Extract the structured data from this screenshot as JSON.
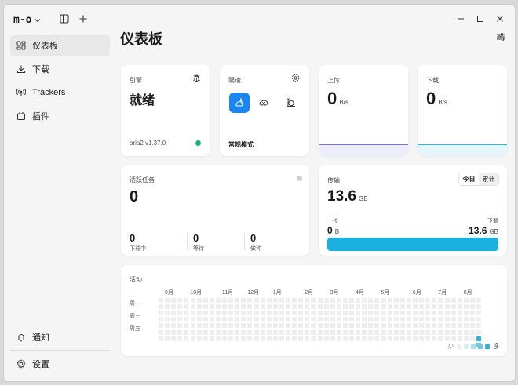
{
  "app": {
    "logo": "m-o"
  },
  "header": {
    "title": "仪表板"
  },
  "sidebar": {
    "items": [
      {
        "label": "仪表板",
        "icon": "dashboard-icon",
        "active": true
      },
      {
        "label": "下载",
        "icon": "download-icon"
      },
      {
        "label": "Trackers",
        "icon": "trackers-icon"
      },
      {
        "label": "插件",
        "icon": "plugin-icon"
      }
    ],
    "bottom": [
      {
        "label": "通知",
        "icon": "bell-icon"
      },
      {
        "label": "设置",
        "icon": "gear-icon"
      }
    ]
  },
  "engine": {
    "label": "引擎",
    "status": "就绪",
    "version": "aria2 v1.37.0",
    "status_color": "#1ab47a"
  },
  "speed_limit": {
    "label": "限速",
    "mode": "常规模式"
  },
  "upload": {
    "label": "上传",
    "value": "0",
    "unit": "B/s"
  },
  "download": {
    "label": "下载",
    "value": "0",
    "unit": "B/s"
  },
  "active_tasks": {
    "label": "活跃任务",
    "value": "0",
    "stats": [
      {
        "value": "0",
        "label": "下载中"
      },
      {
        "value": "0",
        "label": "等待"
      },
      {
        "value": "0",
        "label": "做种"
      }
    ]
  },
  "transfer": {
    "label": "传输",
    "value": "13.6",
    "unit": "GB",
    "tabs": [
      "今日",
      "累计"
    ],
    "upload_label": "上传",
    "upload_value": "0",
    "upload_unit": "B",
    "download_label": "下载",
    "download_value": "13.6",
    "download_unit": "GB"
  },
  "activity": {
    "label": "活动",
    "months": [
      "9月",
      "10月",
      "11月",
      "12月",
      "1月",
      "2月",
      "3月",
      "4月",
      "5月",
      "6月",
      "7月",
      "8月"
    ],
    "weekdays": [
      "周一",
      "周三",
      "周五"
    ],
    "legend_less": "少",
    "legend_more": "多",
    "legend_colors": [
      "#eeeeee",
      "#d3eef7",
      "#a8def0",
      "#6cc8e6",
      "#2fb2dc"
    ]
  },
  "colors": {
    "accent": "#1ab0e0",
    "upload_line": "#7b6ee0",
    "download_line": "#2bb5e0"
  }
}
